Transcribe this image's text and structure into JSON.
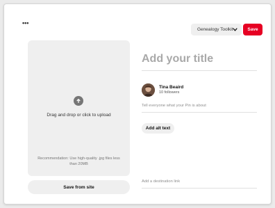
{
  "header": {
    "more_label": "•••",
    "board_selected": "Genealogy Toolkit",
    "save_label": "Save"
  },
  "upload": {
    "instruction": "Drag and drop or click to upload",
    "recommendation": "Recommendation: Use high-quality .jpg files less than 20MB",
    "save_from_site_label": "Save from site"
  },
  "form": {
    "title_placeholder": "Add your title",
    "user": {
      "name": "Tina Beaird",
      "followers": "10 followers"
    },
    "description_placeholder": "Tell everyone what your Pin is about",
    "alt_text_label": "Add alt text",
    "destination_placeholder": "Add a destination link"
  },
  "colors": {
    "accent": "#e60023",
    "secondary_bg": "#efefef"
  },
  "icons": {
    "upload": "arrow-up-circle-icon",
    "dropdown": "chevron-down-icon",
    "more": "ellipsis-icon"
  }
}
